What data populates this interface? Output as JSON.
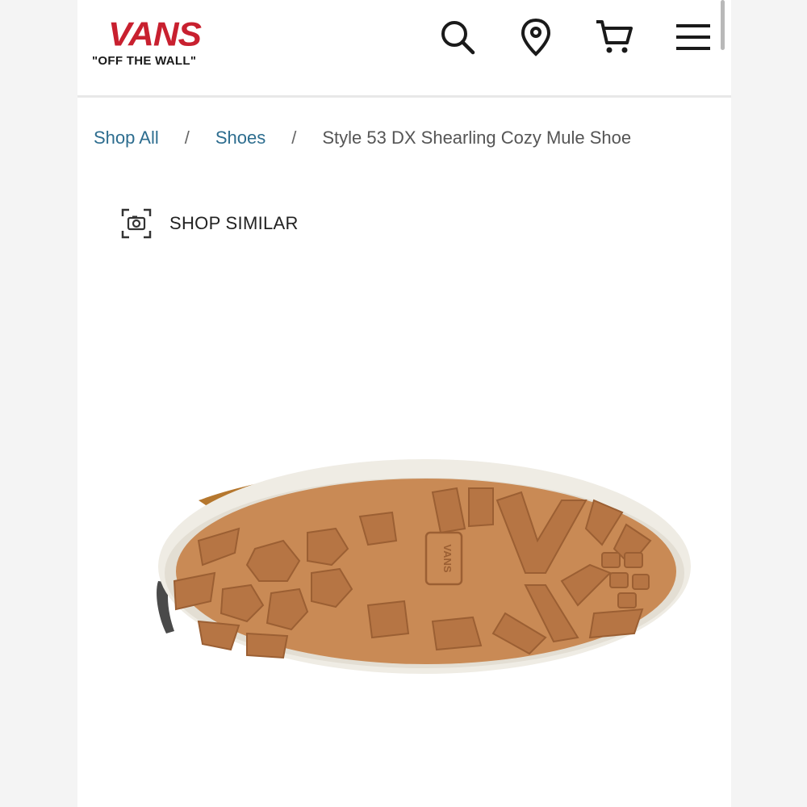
{
  "header": {
    "logo_wordmark": "VANS",
    "logo_tagline": "\"OFF THE WALL\"",
    "icons": [
      "search-icon",
      "location-pin-icon",
      "cart-icon",
      "menu-icon"
    ]
  },
  "breadcrumb": {
    "items": [
      "Shop All",
      "Shoes",
      "Style 53 DX Shearling Cozy Mule Shoe"
    ],
    "separator": "/"
  },
  "shop_similar": {
    "label": "SHOP SIMILAR",
    "icon": "camera-scan-icon"
  },
  "product": {
    "image_subject": "shoe-outsole",
    "sole_brand_mark": "VANS"
  },
  "colors": {
    "brand_red": "#c8202f",
    "link_blue": "#2d6d8f",
    "sole_gum": "#c98a55",
    "sole_rim": "#efece4",
    "upper_tan": "#b5772e"
  }
}
